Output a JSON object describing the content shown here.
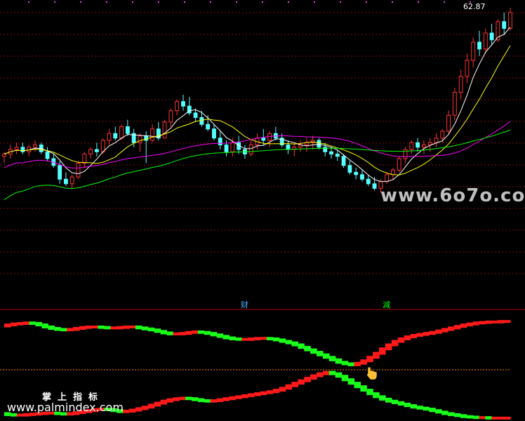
{
  "chart_data": {
    "type": "candlestick-indicator",
    "price_panel": {
      "ohlc": [
        [
          6.8,
          7.0,
          6.5,
          6.9
        ],
        [
          6.9,
          7.3,
          6.7,
          7.1
        ],
        [
          7.1,
          7.4,
          6.9,
          7.2
        ],
        [
          7.2,
          7.4,
          6.9,
          7.0
        ],
        [
          7.0,
          7.3,
          6.8,
          7.2
        ],
        [
          7.2,
          7.5,
          7.0,
          7.3
        ],
        [
          7.3,
          7.4,
          6.9,
          7.0
        ],
        [
          7.0,
          7.2,
          6.6,
          6.7
        ],
        [
          6.7,
          6.9,
          6.3,
          6.4
        ],
        [
          6.4,
          6.6,
          5.6,
          5.8
        ],
        [
          5.8,
          6.1,
          5.5,
          5.6
        ],
        [
          5.6,
          6.0,
          5.4,
          5.9
        ],
        [
          5.9,
          6.6,
          5.8,
          6.5
        ],
        [
          6.5,
          7.0,
          6.3,
          6.9
        ],
        [
          6.9,
          7.2,
          6.7,
          7.1
        ],
        [
          7.1,
          7.4,
          6.8,
          7.0
        ],
        [
          7.0,
          7.6,
          6.9,
          7.5
        ],
        [
          7.5,
          8.0,
          7.3,
          7.8
        ],
        [
          7.8,
          8.1,
          7.5,
          7.6
        ],
        [
          7.6,
          8.2,
          7.5,
          8.1
        ],
        [
          8.1,
          8.4,
          7.7,
          7.8
        ],
        [
          7.8,
          8.0,
          7.2,
          7.4
        ],
        [
          7.4,
          7.8,
          7.0,
          7.7
        ],
        [
          7.7,
          7.9,
          6.5,
          7.5
        ],
        [
          7.5,
          8.2,
          7.4,
          8.0
        ],
        [
          8.0,
          8.3,
          7.5,
          7.6
        ],
        [
          7.6,
          8.4,
          7.6,
          8.3
        ],
        [
          8.3,
          8.9,
          8.1,
          8.8
        ],
        [
          8.8,
          9.3,
          8.6,
          9.2
        ],
        [
          9.2,
          9.5,
          8.8,
          9.0
        ],
        [
          9.0,
          9.4,
          8.6,
          8.7
        ],
        [
          8.7,
          8.9,
          8.3,
          8.5
        ],
        [
          8.5,
          8.8,
          8.1,
          8.2
        ],
        [
          8.2,
          8.6,
          7.9,
          8.0
        ],
        [
          8.0,
          8.2,
          7.5,
          7.6
        ],
        [
          7.6,
          7.9,
          7.1,
          7.3
        ],
        [
          7.3,
          7.5,
          6.8,
          7.0
        ],
        [
          7.0,
          7.6,
          6.8,
          7.4
        ],
        [
          7.4,
          7.7,
          6.9,
          7.1
        ],
        [
          7.1,
          7.3,
          6.7,
          6.9
        ],
        [
          6.9,
          7.5,
          6.8,
          7.3
        ],
        [
          7.3,
          7.8,
          7.1,
          7.6
        ],
        [
          7.6,
          8.0,
          7.3,
          7.5
        ],
        [
          7.5,
          7.9,
          7.2,
          7.8
        ],
        [
          7.8,
          8.1,
          7.5,
          7.6
        ],
        [
          7.6,
          7.8,
          7.2,
          7.3
        ],
        [
          7.3,
          7.5,
          6.9,
          7.1
        ],
        [
          7.1,
          7.4,
          6.8,
          7.2
        ],
        [
          7.2,
          7.5,
          7.0,
          7.3
        ],
        [
          7.3,
          7.6,
          7.0,
          7.4
        ],
        [
          7.4,
          7.7,
          7.1,
          7.5
        ],
        [
          7.5,
          7.6,
          7.1,
          7.2
        ],
        [
          7.2,
          7.4,
          6.8,
          7.0
        ],
        [
          7.0,
          7.2,
          6.7,
          6.9
        ],
        [
          6.9,
          7.1,
          6.6,
          6.8
        ],
        [
          6.8,
          6.9,
          6.3,
          6.4
        ],
        [
          6.4,
          6.6,
          6.0,
          6.1
        ],
        [
          6.1,
          6.3,
          5.8,
          6.0
        ],
        [
          6.0,
          6.2,
          5.7,
          5.8
        ],
        [
          5.8,
          6.0,
          5.5,
          5.6
        ],
        [
          5.6,
          5.9,
          5.3,
          5.4
        ],
        [
          5.4,
          5.8,
          5.2,
          5.7
        ],
        [
          5.7,
          6.1,
          5.6,
          6.0
        ],
        [
          6.0,
          6.3,
          5.8,
          6.2
        ],
        [
          6.2,
          6.8,
          6.1,
          6.7
        ],
        [
          6.7,
          7.2,
          6.5,
          7.1
        ],
        [
          7.1,
          7.5,
          6.9,
          7.4
        ],
        [
          7.4,
          7.6,
          7.0,
          7.2
        ],
        [
          7.2,
          7.5,
          6.9,
          7.3
        ],
        [
          7.3,
          7.6,
          7.0,
          7.4
        ],
        [
          7.4,
          7.8,
          7.2,
          7.6
        ],
        [
          7.6,
          8.0,
          7.4,
          7.9
        ],
        [
          7.9,
          8.8,
          7.8,
          8.6
        ],
        [
          8.6,
          9.8,
          8.4,
          9.6
        ],
        [
          9.6,
          10.6,
          9.3,
          10.3
        ],
        [
          10.3,
          11.3,
          10.0,
          11.0
        ],
        [
          11.0,
          12.0,
          10.7,
          11.8
        ],
        [
          11.8,
          12.3,
          11.2,
          11.5
        ],
        [
          11.5,
          12.4,
          11.3,
          12.2
        ],
        [
          12.2,
          12.6,
          11.7,
          11.9
        ],
        [
          11.9,
          12.8,
          11.8,
          12.7
        ],
        [
          12.7,
          13.1,
          12.1,
          12.4
        ],
        [
          12.4,
          13.3,
          12.3,
          13.1
        ]
      ],
      "moving_averages": [
        {
          "color": "#ffffff"
        },
        {
          "color": "#ffff00"
        },
        {
          "color": "#ff00ff"
        },
        {
          "color": "#00ff00"
        }
      ],
      "colors": {
        "up": "#ff3333",
        "down": "#54ffff"
      },
      "ylim": [
        3.2,
        13.4
      ],
      "high_label": "62.87",
      "top_markers": 18
    },
    "markers": [
      {
        "label": "财",
        "color": "#54aaff",
        "index": 39
      },
      {
        "label": "減",
        "color": "#00ff00",
        "index": 62
      }
    ],
    "indicator_panel": {
      "upper": [
        0.88,
        0.9,
        0.92,
        0.93,
        0.94,
        0.93,
        0.9,
        0.86,
        0.83,
        0.81,
        0.8,
        0.81,
        0.83,
        0.85,
        0.86,
        0.86,
        0.85,
        0.84,
        0.84,
        0.85,
        0.86,
        0.86,
        0.84,
        0.82,
        0.8,
        0.77,
        0.74,
        0.72,
        0.72,
        0.73,
        0.75,
        0.76,
        0.75,
        0.73,
        0.7,
        0.67,
        0.64,
        0.62,
        0.61,
        0.61,
        0.62,
        0.63,
        0.63,
        0.62,
        0.6,
        0.57,
        0.54,
        0.5,
        0.45,
        0.4,
        0.35,
        0.3,
        0.25,
        0.2,
        0.15,
        0.12,
        0.1,
        0.13,
        0.18,
        0.25,
        0.33,
        0.42,
        0.5,
        0.57,
        0.62,
        0.66,
        0.69,
        0.71,
        0.73,
        0.75,
        0.78,
        0.81,
        0.84,
        0.87,
        0.9,
        0.92,
        0.94,
        0.95,
        0.96,
        0.96,
        0.97,
        0.97
      ],
      "lower": [
        -0.88,
        -0.9,
        -0.91,
        -0.91,
        -0.9,
        -0.89,
        -0.88,
        -0.87,
        -0.87,
        -0.88,
        -0.89,
        -0.88,
        -0.86,
        -0.84,
        -0.82,
        -0.8,
        -0.79,
        -0.8,
        -0.82,
        -0.84,
        -0.83,
        -0.81,
        -0.78,
        -0.75,
        -0.71,
        -0.67,
        -0.63,
        -0.6,
        -0.58,
        -0.57,
        -0.58,
        -0.6,
        -0.62,
        -0.63,
        -0.62,
        -0.6,
        -0.58,
        -0.56,
        -0.54,
        -0.52,
        -0.5,
        -0.48,
        -0.46,
        -0.44,
        -0.41,
        -0.37,
        -0.32,
        -0.27,
        -0.22,
        -0.17,
        -0.12,
        -0.08,
        -0.05,
        -0.08,
        -0.13,
        -0.2,
        -0.27,
        -0.34,
        -0.41,
        -0.48,
        -0.54,
        -0.59,
        -0.63,
        -0.66,
        -0.69,
        -0.72,
        -0.75,
        -0.77,
        -0.79,
        -0.82,
        -0.85,
        -0.88,
        -0.9,
        -0.92,
        -0.94,
        -0.95,
        -0.96,
        -0.96,
        -0.97,
        -0.97,
        -0.97,
        -0.97
      ],
      "colors": {
        "rising": "#ff1a1a",
        "falling": "#1aff1a",
        "zero_line": "#ff7f00"
      },
      "ylim": [
        -1.0,
        1.0
      ]
    }
  },
  "watermark": "www.6o7o.com",
  "caption": "掌上指标",
  "site": "www.palmindex.com",
  "colors": {
    "grid": "#7a1010",
    "divider": "#b00000",
    "background": "#000000"
  }
}
